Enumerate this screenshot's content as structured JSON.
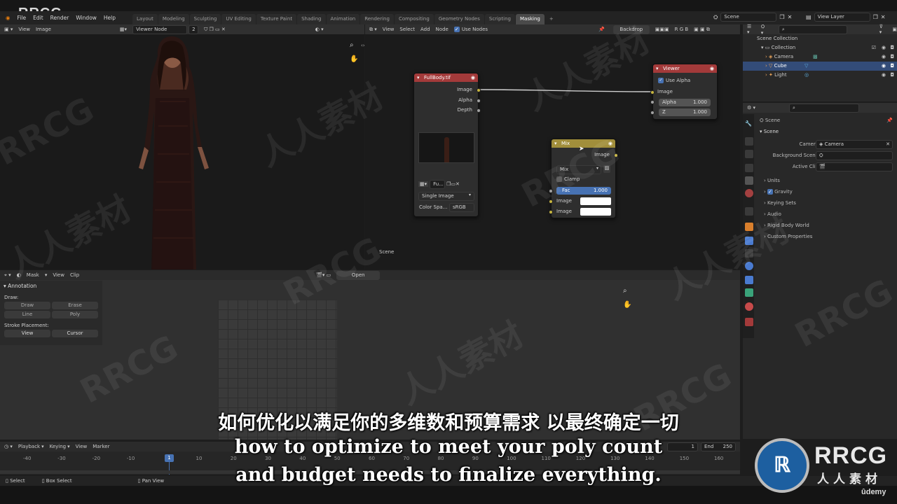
{
  "watermark_top_logo": "RRCG",
  "menu": {
    "file": "File",
    "edit": "Edit",
    "render": "Render",
    "window": "Window",
    "help": "Help"
  },
  "workspaces": [
    "Layout",
    "Modeling",
    "Sculpting",
    "UV Editing",
    "Texture Paint",
    "Shading",
    "Animation",
    "Rendering",
    "Compositing",
    "Geometry Nodes",
    "Scripting",
    "Masking"
  ],
  "active_workspace": "Masking",
  "add_tab": "+",
  "scene_field": "Scene",
  "view_layer_field": "View Layer",
  "image_editor": {
    "view": "View",
    "image": "Image",
    "image_name": "Viewer Node",
    "slot": "2",
    "scene_label": "Scene"
  },
  "node_editor": {
    "view": "View",
    "select": "Select",
    "add": "Add",
    "node": "Node",
    "use_nodes": "Use Nodes",
    "backdrop": "Backdrop",
    "channels": "R G B"
  },
  "nodes": {
    "image": {
      "title": "FullBody.tif",
      "outputs": [
        "Image",
        "Alpha",
        "Depth"
      ],
      "file": "Fu...",
      "source": "Single Image",
      "color_space_label": "Color Spa...",
      "color_space": "sRGB"
    },
    "viewer": {
      "title": "Viewer",
      "use_alpha": "Use Alpha",
      "input_image": "Image",
      "alpha_label": "Alpha",
      "alpha_value": "1.000",
      "z_label": "Z",
      "z_value": "1.000"
    },
    "mix": {
      "title": "Mix",
      "output": "Image",
      "blend": "Mix",
      "clamp": "Clamp",
      "fac_label": "Fac",
      "fac_value": "1.000",
      "in1": "Image",
      "in2": "Image"
    }
  },
  "outliner": {
    "title": "Scene Collection",
    "items": [
      {
        "label": "Collection"
      },
      {
        "label": "Camera"
      },
      {
        "label": "Cube"
      },
      {
        "label": "Light"
      }
    ]
  },
  "properties": {
    "crumb": "Scene",
    "section": "Scene",
    "camera_label": "Camera",
    "camera_value": "Camera",
    "background_scene_label": "Background Scene",
    "active_clip_label": "Active Clip",
    "panels": [
      "Units",
      "Gravity",
      "Keying Sets",
      "Audio",
      "Rigid Body World",
      "Custom Properties"
    ]
  },
  "clip_editor": {
    "mode": "Mask",
    "view": "View",
    "clip": "Clip",
    "open": "Open"
  },
  "annotation": {
    "title": "Annotation",
    "draw_label": "Draw:",
    "draw": "Draw",
    "erase": "Erase",
    "line": "Line",
    "poly": "Poly",
    "stroke_label": "Stroke Placement:",
    "view": "View",
    "cursor": "Cursor"
  },
  "timeline": {
    "playback": "Playback",
    "keying": "Keying",
    "view": "View",
    "marker": "Marker",
    "current_frame": "1",
    "start": "1",
    "end_label": "End",
    "end": "250",
    "ticks": [
      "-40",
      "-30",
      "-20",
      "-10",
      "10",
      "20",
      "30",
      "40",
      "50",
      "60",
      "70",
      "80",
      "90",
      "100",
      "110",
      "120",
      "130",
      "140",
      "150",
      "160"
    ]
  },
  "statusbar": {
    "select": "Select",
    "box_select": "Box Select",
    "pan_view": "Pan View"
  },
  "subtitles": {
    "zh": "如何优化以满足你的多维数和预算需求 以最终确定一切",
    "en1": "how to optimize to meet your poly count",
    "en2": "and budget needs to finalize everything."
  },
  "brand": {
    "logo": "RRCG",
    "logo_sub": "人人素材",
    "udemy": "ûdemy"
  },
  "watermark_text": {
    "latin": "RRCG",
    "cjk": "人人素材"
  },
  "colors": {
    "selection": "#334c78",
    "image_node": "#a33a3a",
    "mix_node": "#a18e3b",
    "fac": "#4772b3"
  }
}
